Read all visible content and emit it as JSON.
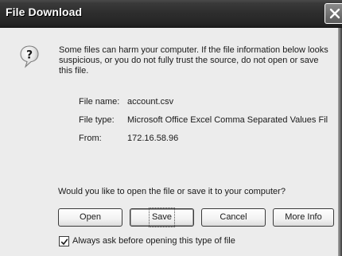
{
  "dialog": {
    "title": "File Download",
    "close_icon": "close-icon",
    "warning_icon": "question-icon",
    "warning_text": "Some files can harm your computer. If the file information below looks suspicious, or you do not fully trust the source, do not open or save this file.",
    "file_info": [
      {
        "label": "File name:",
        "value": "account.csv"
      },
      {
        "label": "File type:",
        "value": "Microsoft Office Excel Comma Separated Values Fil"
      },
      {
        "label": "From:",
        "value": "172.16.58.96"
      }
    ],
    "prompt": "Would you like to open the file or save it to your computer?",
    "buttons": {
      "open": "Open",
      "save": "Save",
      "cancel": "Cancel",
      "more_info": "More Info"
    },
    "always_ask": {
      "label": "Always ask before opening this type of file",
      "checked": true
    }
  }
}
